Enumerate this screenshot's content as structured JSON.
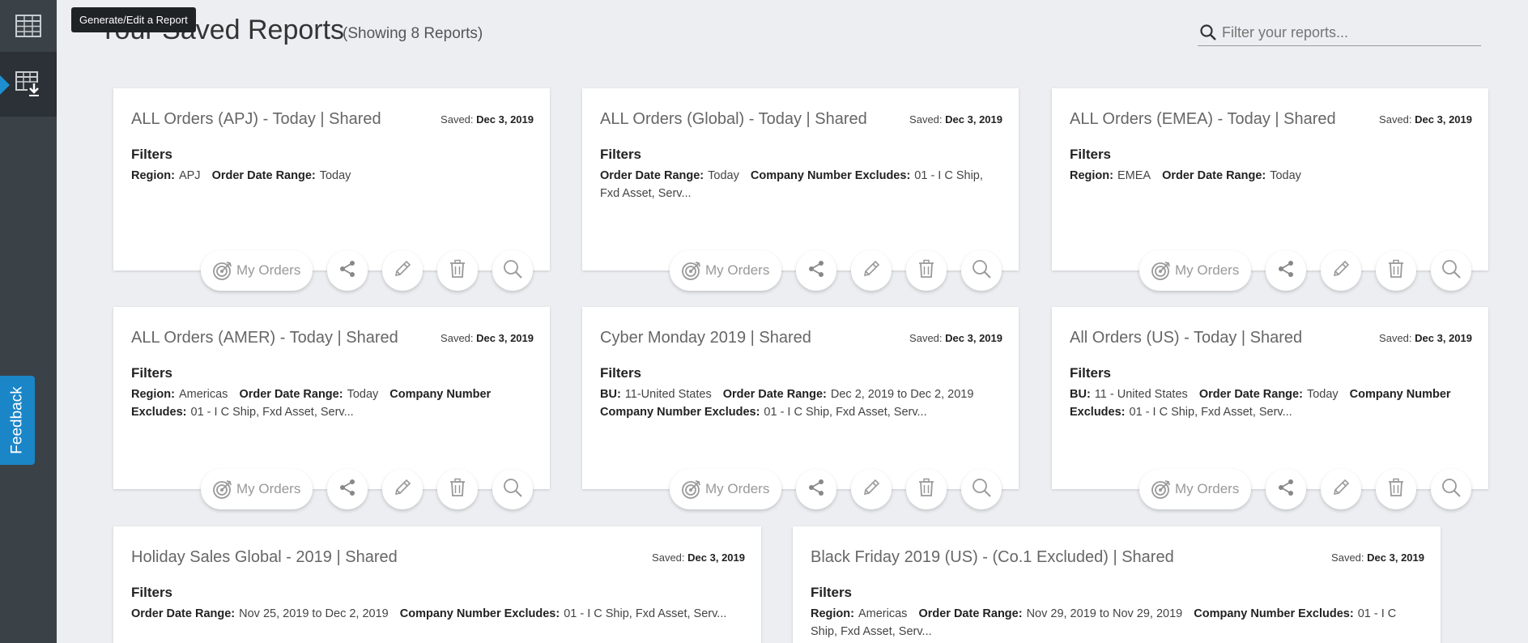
{
  "tooltip": "Generate/Edit a Report",
  "header": {
    "title": "Your Saved Reports",
    "count": "(Showing 8 Reports)"
  },
  "search": {
    "placeholder": "Filter your reports..."
  },
  "feedback": "Feedback",
  "labels": {
    "filters": "Filters",
    "saved": "Saved:",
    "my_orders": "My Orders"
  },
  "reports": [
    {
      "title": "ALL Orders (APJ) - Today | Shared",
      "saved_date": "Dec 3, 2019",
      "filters": [
        {
          "label": "Region:",
          "value": "APJ"
        },
        {
          "label": "Order Date Range:",
          "value": "Today"
        }
      ]
    },
    {
      "title": "ALL Orders (Global) - Today | Shared",
      "saved_date": "Dec 3, 2019",
      "filters": [
        {
          "label": "Order Date Range:",
          "value": "Today"
        },
        {
          "label": "Company Number Excludes:",
          "value": "01 - I C Ship, Fxd Asset, Serv..."
        }
      ]
    },
    {
      "title": "ALL Orders (EMEA) - Today | Shared",
      "saved_date": "Dec 3, 2019",
      "filters": [
        {
          "label": "Region:",
          "value": "EMEA"
        },
        {
          "label": "Order Date Range:",
          "value": "Today"
        }
      ]
    },
    {
      "title": "ALL Orders (AMER) - Today | Shared",
      "saved_date": "Dec 3, 2019",
      "filters": [
        {
          "label": "Region:",
          "value": "Americas"
        },
        {
          "label": "Order Date Range:",
          "value": "Today"
        },
        {
          "label": "Company Number Excludes:",
          "value": "01 - I C Ship, Fxd Asset, Serv..."
        }
      ]
    },
    {
      "title": "Cyber Monday 2019 | Shared",
      "saved_date": "Dec 3, 2019",
      "filters": [
        {
          "label": "BU:",
          "value": "11-United States"
        },
        {
          "label": "Order Date Range:",
          "value": "Dec 2, 2019 to Dec 2, 2019"
        },
        {
          "label": "Company Number Excludes:",
          "value": "01 - I C Ship, Fxd Asset, Serv..."
        }
      ]
    },
    {
      "title": "All Orders (US) - Today | Shared",
      "saved_date": "Dec 3, 2019",
      "filters": [
        {
          "label": "BU:",
          "value": "11 - United States"
        },
        {
          "label": "Order Date Range:",
          "value": "Today"
        },
        {
          "label": "Company Number Excludes:",
          "value": "01 - I C Ship, Fxd Asset, Serv..."
        }
      ]
    },
    {
      "title": "Holiday Sales Global - 2019 | Shared",
      "saved_date": "Dec 3, 2019",
      "filters": [
        {
          "label": "Order Date Range:",
          "value": "Nov 25, 2019 to Dec 2, 2019"
        },
        {
          "label": "Company Number Excludes:",
          "value": "01 - I C Ship, Fxd Asset, Serv..."
        }
      ]
    },
    {
      "title": "Black Friday 2019 (US) - (Co.1 Excluded) | Shared",
      "saved_date": "Dec 3, 2019",
      "filters": [
        {
          "label": "Region:",
          "value": "Americas"
        },
        {
          "label": "Order Date Range:",
          "value": "Nov 29, 2019 to Nov 29, 2019"
        },
        {
          "label": "Company Number Excludes:",
          "value": "01 - I C Ship, Fxd Asset, Serv..."
        }
      ]
    }
  ]
}
